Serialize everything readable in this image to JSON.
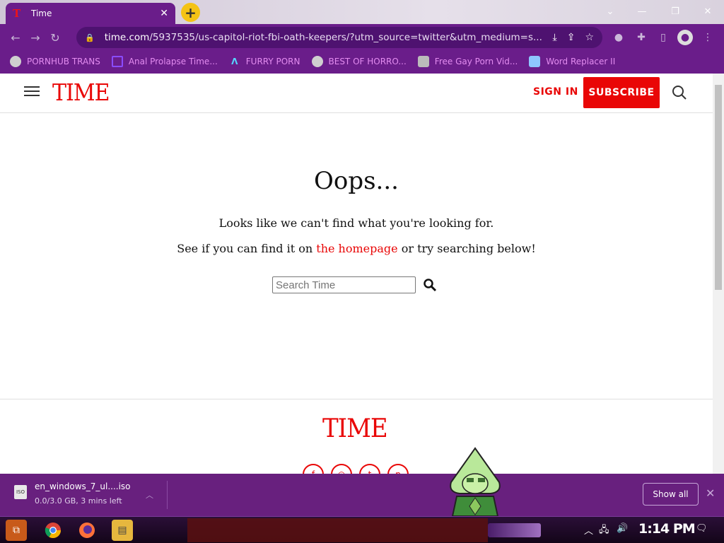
{
  "browser": {
    "tab_title": "Time",
    "tab_favicon": "T",
    "url_domain": "time.com",
    "url_path": "/5937535/us-capitol-riot-fbi-oath-keepers/?utm_source=twitter&utm_medium=s...",
    "bookmarks": [
      {
        "label": "PORNHUB TRANS",
        "icon": "globe-icon"
      },
      {
        "label": "Anal Prolapse Time...",
        "icon": "bracket-icon"
      },
      {
        "label": "FURRY PORN",
        "icon": "lambda-icon"
      },
      {
        "label": "BEST OF HORRO...",
        "icon": "globe-icon"
      },
      {
        "label": "Free Gay Porn Vid...",
        "icon": "robot-icon"
      },
      {
        "label": "Word Replacer II",
        "icon": "wr-icon"
      }
    ]
  },
  "site": {
    "logo_text": "TIME",
    "sign_in": "SIGN IN",
    "subscribe": "SUBSCRIBE",
    "heading": "Oops...",
    "line1": "Looks like we can't find what you're looking for.",
    "line2_prefix": "See if you can find it on ",
    "line2_link": "the homepage",
    "line2_suffix": " or try searching below!",
    "search_placeholder": "Search Time",
    "footer_logo": "TIME",
    "social": [
      "facebook-icon",
      "instagram-icon",
      "twitter-icon",
      "pinterest-icon"
    ],
    "social_glyphs": [
      "f",
      "◎",
      "t",
      "p"
    ]
  },
  "download": {
    "filename": "en_windows_7_ul....iso",
    "status": "0.0/3.0 GB, 3 mins left",
    "icon_text": "ISO",
    "show_all": "Show all"
  },
  "taskbar": {
    "clock": "1:14 PM"
  },
  "colors": {
    "brand_red": "#e90606",
    "chrome_purple": "#6a1d8a",
    "newtab_yellow": "#f4c315"
  }
}
